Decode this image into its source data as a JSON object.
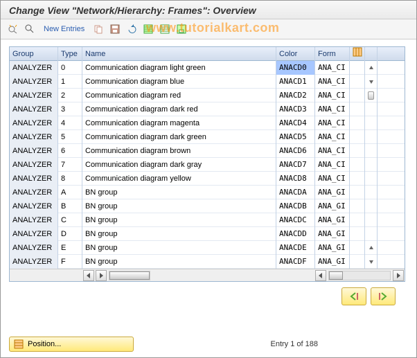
{
  "header": {
    "title": "Change View \"Network/Hierarchy: Frames\": Overview"
  },
  "toolbar": {
    "new_entries": "New Entries"
  },
  "watermark": "www.tutorialkart.com",
  "columns": {
    "group": "Group",
    "type": "Type",
    "name": "Name",
    "color": "Color",
    "form": "Form"
  },
  "rows": [
    {
      "group": "ANALYZER",
      "type": "0",
      "name": "Communication diagram light green",
      "color": "ANACD0",
      "form": "ANA_CI",
      "sel": true
    },
    {
      "group": "ANALYZER",
      "type": "1",
      "name": "Communication diagram blue",
      "color": "ANACD1",
      "form": "ANA_CI"
    },
    {
      "group": "ANALYZER",
      "type": "2",
      "name": "Communication diagram red",
      "color": "ANACD2",
      "form": "ANA_CI"
    },
    {
      "group": "ANALYZER",
      "type": "3",
      "name": "Communication diagram dark red",
      "color": "ANACD3",
      "form": "ANA_CI"
    },
    {
      "group": "ANALYZER",
      "type": "4",
      "name": "Communication diagram magenta",
      "color": "ANACD4",
      "form": "ANA_CI"
    },
    {
      "group": "ANALYZER",
      "type": "5",
      "name": "Communication diagram dark green",
      "color": "ANACD5",
      "form": "ANA_CI"
    },
    {
      "group": "ANALYZER",
      "type": "6",
      "name": "Communication diagram brown",
      "color": "ANACD6",
      "form": "ANA_CI"
    },
    {
      "group": "ANALYZER",
      "type": "7",
      "name": "Communication diagram dark gray",
      "color": "ANACD7",
      "form": "ANA_CI"
    },
    {
      "group": "ANALYZER",
      "type": "8",
      "name": "Communication diagram yellow",
      "color": "ANACD8",
      "form": "ANA_CI"
    },
    {
      "group": "ANALYZER",
      "type": "A",
      "name": "BN group",
      "color": "ANACDA",
      "form": "ANA_GI"
    },
    {
      "group": "ANALYZER",
      "type": "B",
      "name": "BN group",
      "color": "ANACDB",
      "form": "ANA_GI"
    },
    {
      "group": "ANALYZER",
      "type": "C",
      "name": "BN group",
      "color": "ANACDC",
      "form": "ANA_GI"
    },
    {
      "group": "ANALYZER",
      "type": "D",
      "name": "BN group",
      "color": "ANACDD",
      "form": "ANA_GI"
    },
    {
      "group": "ANALYZER",
      "type": "E",
      "name": "BN group",
      "color": "ANACDE",
      "form": "ANA_GI"
    },
    {
      "group": "ANALYZER",
      "type": "F",
      "name": "BN group",
      "color": "ANACDF",
      "form": "ANA_GI"
    }
  ],
  "footer": {
    "position": "Position...",
    "entry": "Entry 1 of 188"
  }
}
